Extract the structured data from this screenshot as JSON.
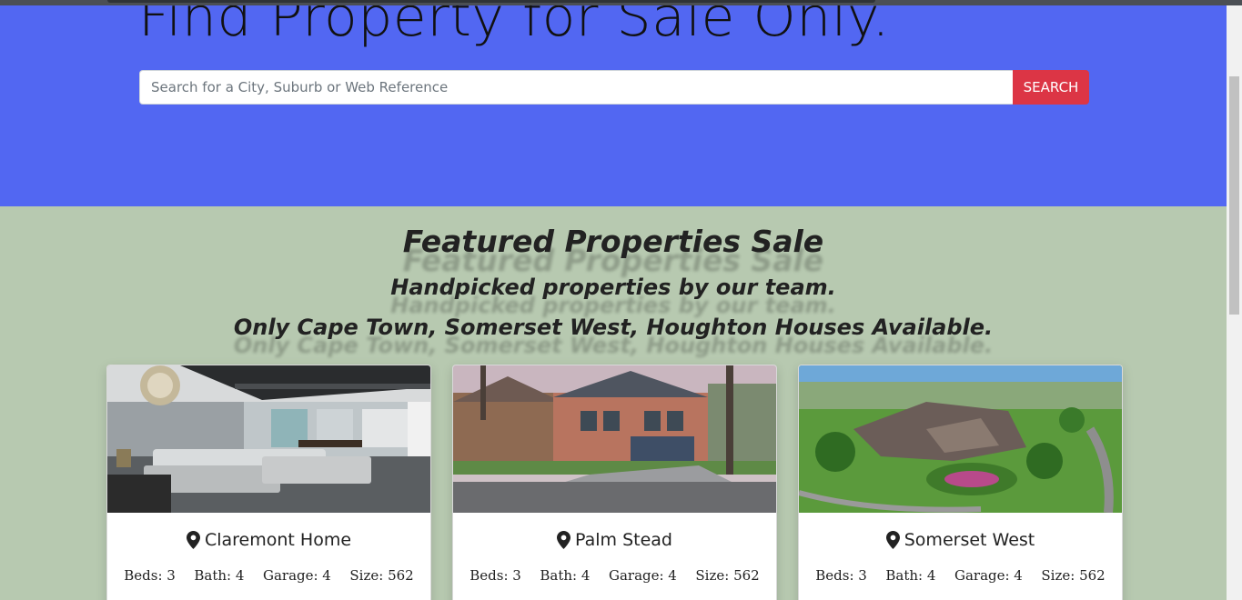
{
  "hero": {
    "title": "Find Property for Sale Only.",
    "search": {
      "placeholder": "Search for a City, Suburb or Web Reference",
      "value": "",
      "button_label": "SEARCH"
    }
  },
  "featured": {
    "title": "Featured Properties Sale",
    "subtitle": "Handpicked properties by our team.",
    "availability": "Only Cape Town, Somerset West, Houghton Houses Available."
  },
  "properties": [
    {
      "name": "Claremont Home",
      "image": "living-room-photo",
      "stats": {
        "beds": "Beds: 3",
        "bath": "Bath: 4",
        "garage": "Garage: 4",
        "size": "Size: 562"
      }
    },
    {
      "name": "Palm Stead",
      "image": "house-exterior-photo",
      "stats": {
        "beds": "Beds: 3",
        "bath": "Bath: 4",
        "garage": "Garage: 4",
        "size": "Size: 562"
      }
    },
    {
      "name": "Somerset West",
      "image": "aerial-house-photo",
      "stats": {
        "beds": "Beds: 3",
        "bath": "Bath: 4",
        "garage": "Garage: 4",
        "size": "Size: 562"
      }
    }
  ],
  "icons": {
    "location": "map-pin-icon"
  },
  "colors": {
    "hero_bg": "#5267f2",
    "section_bg": "#b7c9b0",
    "search_button": "#dc3545"
  }
}
